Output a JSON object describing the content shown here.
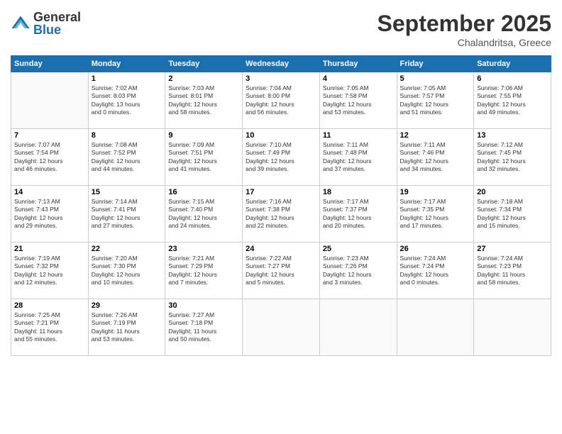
{
  "header": {
    "logo_general": "General",
    "logo_blue": "Blue",
    "month_title": "September 2025",
    "location": "Chalandritsa, Greece"
  },
  "days_of_week": [
    "Sunday",
    "Monday",
    "Tuesday",
    "Wednesday",
    "Thursday",
    "Friday",
    "Saturday"
  ],
  "weeks": [
    [
      {
        "day": "",
        "content": ""
      },
      {
        "day": "1",
        "content": "Sunrise: 7:02 AM\nSunset: 8:03 PM\nDaylight: 13 hours\nand 0 minutes."
      },
      {
        "day": "2",
        "content": "Sunrise: 7:03 AM\nSunset: 8:01 PM\nDaylight: 12 hours\nand 58 minutes."
      },
      {
        "day": "3",
        "content": "Sunrise: 7:04 AM\nSunset: 8:00 PM\nDaylight: 12 hours\nand 56 minutes."
      },
      {
        "day": "4",
        "content": "Sunrise: 7:05 AM\nSunset: 7:58 PM\nDaylight: 12 hours\nand 53 minutes."
      },
      {
        "day": "5",
        "content": "Sunrise: 7:05 AM\nSunset: 7:57 PM\nDaylight: 12 hours\nand 51 minutes."
      },
      {
        "day": "6",
        "content": "Sunrise: 7:06 AM\nSunset: 7:55 PM\nDaylight: 12 hours\nand 49 minutes."
      }
    ],
    [
      {
        "day": "7",
        "content": "Sunrise: 7:07 AM\nSunset: 7:54 PM\nDaylight: 12 hours\nand 46 minutes."
      },
      {
        "day": "8",
        "content": "Sunrise: 7:08 AM\nSunset: 7:52 PM\nDaylight: 12 hours\nand 44 minutes."
      },
      {
        "day": "9",
        "content": "Sunrise: 7:09 AM\nSunset: 7:51 PM\nDaylight: 12 hours\nand 41 minutes."
      },
      {
        "day": "10",
        "content": "Sunrise: 7:10 AM\nSunset: 7:49 PM\nDaylight: 12 hours\nand 39 minutes."
      },
      {
        "day": "11",
        "content": "Sunrise: 7:11 AM\nSunset: 7:48 PM\nDaylight: 12 hours\nand 37 minutes."
      },
      {
        "day": "12",
        "content": "Sunrise: 7:11 AM\nSunset: 7:46 PM\nDaylight: 12 hours\nand 34 minutes."
      },
      {
        "day": "13",
        "content": "Sunrise: 7:12 AM\nSunset: 7:45 PM\nDaylight: 12 hours\nand 32 minutes."
      }
    ],
    [
      {
        "day": "14",
        "content": "Sunrise: 7:13 AM\nSunset: 7:43 PM\nDaylight: 12 hours\nand 29 minutes."
      },
      {
        "day": "15",
        "content": "Sunrise: 7:14 AM\nSunset: 7:41 PM\nDaylight: 12 hours\nand 27 minutes."
      },
      {
        "day": "16",
        "content": "Sunrise: 7:15 AM\nSunset: 7:40 PM\nDaylight: 12 hours\nand 24 minutes."
      },
      {
        "day": "17",
        "content": "Sunrise: 7:16 AM\nSunset: 7:38 PM\nDaylight: 12 hours\nand 22 minutes."
      },
      {
        "day": "18",
        "content": "Sunrise: 7:17 AM\nSunset: 7:37 PM\nDaylight: 12 hours\nand 20 minutes."
      },
      {
        "day": "19",
        "content": "Sunrise: 7:17 AM\nSunset: 7:35 PM\nDaylight: 12 hours\nand 17 minutes."
      },
      {
        "day": "20",
        "content": "Sunrise: 7:18 AM\nSunset: 7:34 PM\nDaylight: 12 hours\nand 15 minutes."
      }
    ],
    [
      {
        "day": "21",
        "content": "Sunrise: 7:19 AM\nSunset: 7:32 PM\nDaylight: 12 hours\nand 12 minutes."
      },
      {
        "day": "22",
        "content": "Sunrise: 7:20 AM\nSunset: 7:30 PM\nDaylight: 12 hours\nand 10 minutes."
      },
      {
        "day": "23",
        "content": "Sunrise: 7:21 AM\nSunset: 7:29 PM\nDaylight: 12 hours\nand 7 minutes."
      },
      {
        "day": "24",
        "content": "Sunrise: 7:22 AM\nSunset: 7:27 PM\nDaylight: 12 hours\nand 5 minutes."
      },
      {
        "day": "25",
        "content": "Sunrise: 7:23 AM\nSunset: 7:26 PM\nDaylight: 12 hours\nand 3 minutes."
      },
      {
        "day": "26",
        "content": "Sunrise: 7:24 AM\nSunset: 7:24 PM\nDaylight: 12 hours\nand 0 minutes."
      },
      {
        "day": "27",
        "content": "Sunrise: 7:24 AM\nSunset: 7:23 PM\nDaylight: 11 hours\nand 58 minutes."
      }
    ],
    [
      {
        "day": "28",
        "content": "Sunrise: 7:25 AM\nSunset: 7:21 PM\nDaylight: 11 hours\nand 55 minutes."
      },
      {
        "day": "29",
        "content": "Sunrise: 7:26 AM\nSunset: 7:19 PM\nDaylight: 11 hours\nand 53 minutes."
      },
      {
        "day": "30",
        "content": "Sunrise: 7:27 AM\nSunset: 7:18 PM\nDaylight: 11 hours\nand 50 minutes."
      },
      {
        "day": "",
        "content": ""
      },
      {
        "day": "",
        "content": ""
      },
      {
        "day": "",
        "content": ""
      },
      {
        "day": "",
        "content": ""
      }
    ]
  ]
}
